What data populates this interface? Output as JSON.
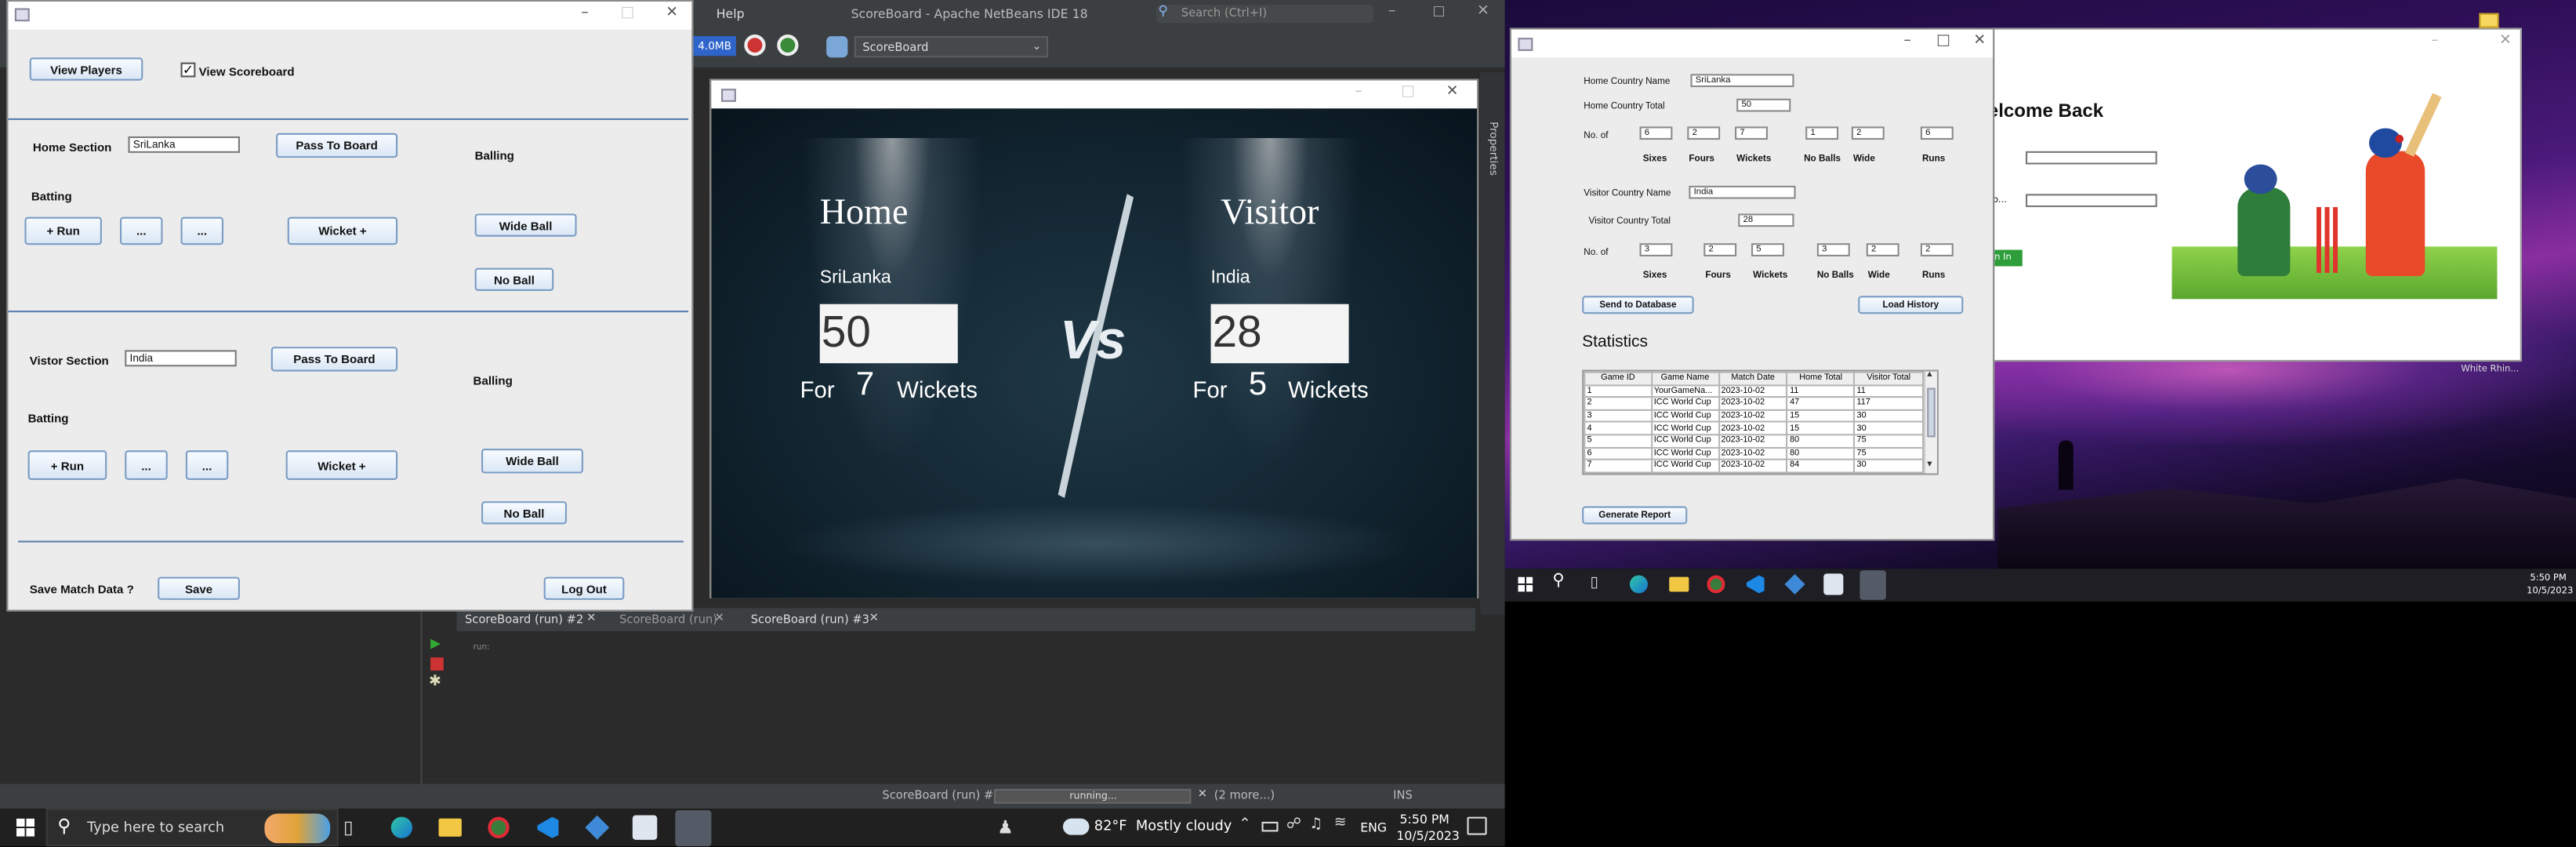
{
  "netbeans": {
    "title": "ScoreBoard - Apache NetBeans IDE 18",
    "menu_help": "Help",
    "search_placeholder": "Search (Ctrl+I)",
    "memory": "4.0MB",
    "config_select": "ScoreBoard",
    "side_tab": "Properties",
    "output_tabs": [
      "ScoreBoard (run) #2",
      "ScoreBoard (run)",
      "ScoreBoard (run) #3"
    ],
    "output_text": "run:",
    "status_run": "ScoreBoard (run) #3",
    "status_running": "running...",
    "status_more": "(2 more...)",
    "status_ins": "INS"
  },
  "control": {
    "view_players": "View Players",
    "view_scoreboard": "View Scoreboard",
    "home_section": "Home Section",
    "home_country": "SriLanka",
    "pass_to_board": "Pass To Board",
    "balling": "Balling",
    "batting": "Batting",
    "run": "+ Run",
    "dots": "...",
    "wicket": "Wicket +",
    "wide_ball": "Wide Ball",
    "no_ball": "No Ball",
    "visitor_section": "Vistor Section",
    "visitor_country": "India",
    "save_prompt": "Save Match Data ?",
    "save": "Save",
    "logout": "Log Out"
  },
  "board": {
    "home_label": "Home",
    "visitor_label": "Visitor",
    "home_team": "SriLanka",
    "visitor_team": "India",
    "home_score": "50",
    "visitor_score": "28",
    "for": "For",
    "home_wickets": "7",
    "visitor_wickets": "5",
    "wickets": "Wickets",
    "vs": "Vs"
  },
  "stats": {
    "home_country_name": "Home Country Name",
    "home_country_value": "SriLanka",
    "home_country_total": "Home Country Total",
    "home_total_value": "50",
    "no_of": "No. of",
    "home_values": [
      "6",
      "2",
      "7",
      "1",
      "2",
      "6"
    ],
    "col_labels": [
      "Sixes",
      "Fours",
      "Wickets",
      "No Balls",
      "Wide",
      "Runs"
    ],
    "visitor_country_name": "Visitor Country Name",
    "visitor_country_value": "India",
    "visitor_country_total": "Visitor Country Total",
    "visitor_total_value": "28",
    "visitor_values": [
      "3",
      "2",
      "5",
      "3",
      "2",
      "2"
    ],
    "send_db": "Send to Database",
    "load_history": "Load History",
    "statistics": "Statistics",
    "generate_report": "Generate Report",
    "table_headers": [
      "Game ID",
      "Game Name",
      "Match Date",
      "Home Total",
      "Visitor Total"
    ],
    "table_rows": [
      [
        "1",
        "YourGameNa...",
        "2023-10-02",
        "11",
        "11"
      ],
      [
        "2",
        "ICC World Cup",
        "2023-10-02",
        "47",
        "117"
      ],
      [
        "3",
        "ICC World Cup",
        "2023-10-02",
        "15",
        "30"
      ],
      [
        "4",
        "ICC World Cup",
        "2023-10-02",
        "15",
        "30"
      ],
      [
        "5",
        "ICC World Cup",
        "2023-10-02",
        "80",
        "75"
      ],
      [
        "6",
        "ICC World Cup",
        "2023-10-02",
        "80",
        "75"
      ],
      [
        "7",
        "ICC World Cup",
        "2023-10-02",
        "84",
        "30"
      ]
    ]
  },
  "login": {
    "welcome": "elcome Back",
    "label_pw": "o...",
    "login_btn": "n In"
  },
  "desktop": {
    "wallpaper_label": "White Rhin...",
    "time_small": "5:50 PM",
    "date_small": "10/5/2023"
  },
  "taskbar": {
    "search_placeholder": "Type here to search",
    "weather": "82°F  Mostly cloudy",
    "lang": "ENG",
    "time": "5:50 PM",
    "date": "10/5/2023"
  }
}
